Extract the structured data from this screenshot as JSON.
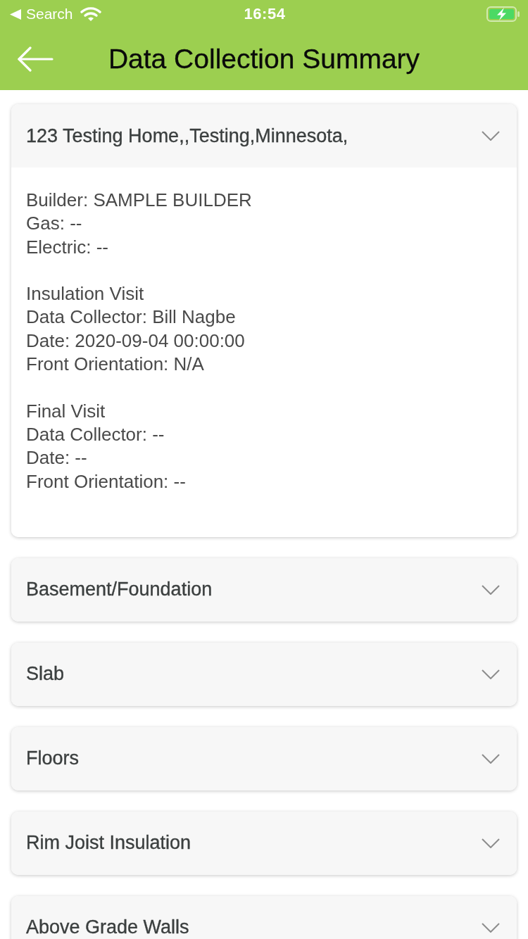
{
  "status_bar": {
    "back_label": "Search",
    "time": "16:54"
  },
  "header": {
    "title": "Data Collection Summary"
  },
  "sections": [
    {
      "title": "123 Testing Home,,Testing,Minnesota,",
      "expanded": true,
      "detail_groups": [
        {
          "lines": [
            "Builder: SAMPLE BUILDER",
            "Gas: --",
            "Electric: --"
          ]
        },
        {
          "lines": [
            "Insulation Visit",
            "Data Collector: Bill Nagbe",
            "Date: 2020-09-04 00:00:00",
            "Front Orientation: N/A"
          ]
        },
        {
          "lines": [
            "Final Visit",
            "Data Collector: --",
            "Date: --",
            "Front Orientation: --"
          ]
        }
      ]
    },
    {
      "title": "Basement/Foundation",
      "expanded": false
    },
    {
      "title": "Slab",
      "expanded": false
    },
    {
      "title": "Floors",
      "expanded": false
    },
    {
      "title": "Rim Joist Insulation",
      "expanded": false
    },
    {
      "title": "Above Grade Walls",
      "expanded": false
    }
  ]
}
